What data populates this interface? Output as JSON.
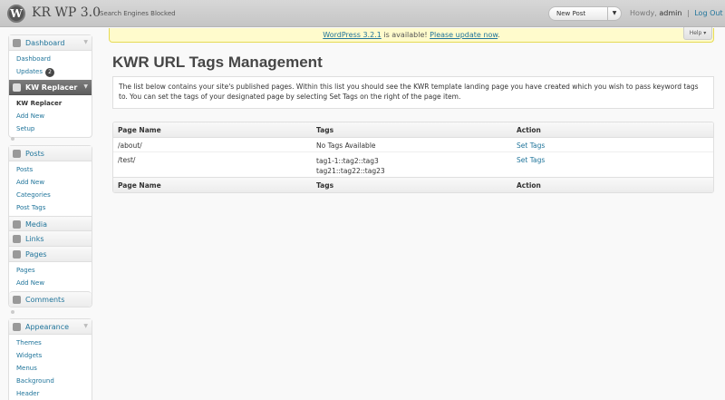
{
  "header": {
    "logo_letter": "W",
    "site_title": "KR WP 3.0",
    "site_note": "Search Engines Blocked",
    "favorite_action": "New Post",
    "howdy": "Howdy,",
    "username": "admin",
    "separator": "|",
    "logout": "Log Out"
  },
  "nag": {
    "version_link": "WordPress 3.2.1",
    "middle_text": " is available! ",
    "update_link": "Please update now",
    "period": "."
  },
  "help_tab": "Help",
  "sidebar": {
    "dashboard": {
      "label": "Dashboard",
      "items": [
        "Dashboard",
        "Updates"
      ],
      "updates_count": "2"
    },
    "kw_replacer": {
      "label": "KW Replacer",
      "items": [
        "KW Replacer",
        "Add New",
        "Setup"
      ]
    },
    "posts": {
      "label": "Posts",
      "items": [
        "Posts",
        "Add New",
        "Categories",
        "Post Tags"
      ]
    },
    "media": {
      "label": "Media"
    },
    "links": {
      "label": "Links"
    },
    "pages": {
      "label": "Pages",
      "items": [
        "Pages",
        "Add New"
      ]
    },
    "comments": {
      "label": "Comments"
    },
    "appearance": {
      "label": "Appearance",
      "items": [
        "Themes",
        "Widgets",
        "Menus",
        "Background",
        "Header"
      ]
    }
  },
  "main": {
    "title": "KWR URL Tags Management",
    "description": "The list below contains your site's published pages. Within this list you should see the KWR template landing page you have created which you wish to pass keyword tags to. You can set the tags of your designated page by selecting Set Tags on the right of the page item.",
    "table": {
      "columns": [
        "Page Name",
        "Tags",
        "Action"
      ],
      "rows": [
        {
          "page": "/about/",
          "tags": [
            "No Tags Available"
          ],
          "action": "Set Tags"
        },
        {
          "page": "/test/",
          "tags": [
            "tag1-1::tag2::tag3",
            "tag21::tag22::tag23"
          ],
          "action": "Set Tags"
        }
      ]
    }
  },
  "colors": {
    "link": "#21759b",
    "nag_bg": "#fffbcc",
    "header_bg": "#d7d7d7"
  }
}
